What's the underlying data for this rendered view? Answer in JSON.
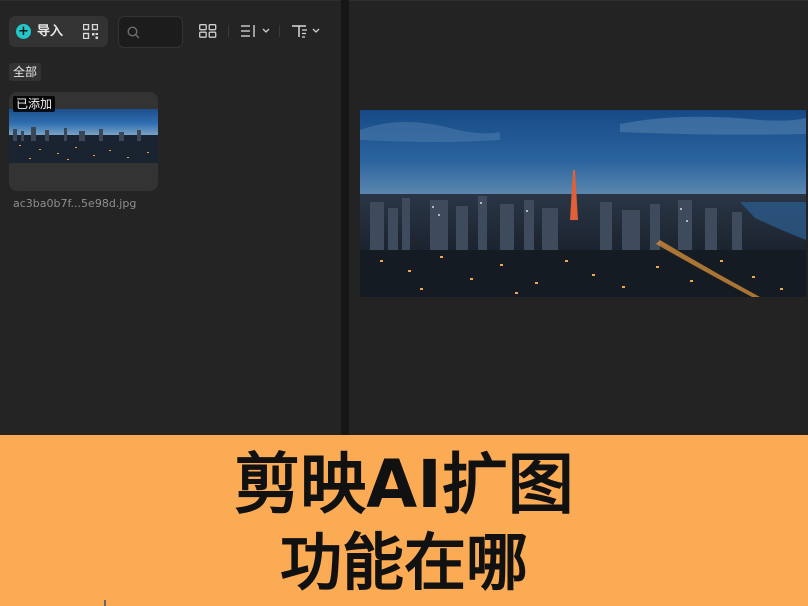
{
  "toolbar": {
    "import_label": "导入",
    "import_icon": "plus-circle-icon",
    "qr_icon": "qr-code-icon",
    "search_icon": "search-icon",
    "view_icon": "grid-view-icon",
    "sort_icon": "sort-icon",
    "filter_icon": "filter-icon",
    "accent_color": "#22c7c9"
  },
  "tabs": {
    "all_label": "全部"
  },
  "media": {
    "items": [
      {
        "badge": "已添加",
        "filename": "ac3ba0b7f...5e98d.jpg"
      }
    ]
  },
  "banner": {
    "line1": "剪映AI扩图",
    "line2": "功能在哪",
    "background": "#fbab54"
  }
}
